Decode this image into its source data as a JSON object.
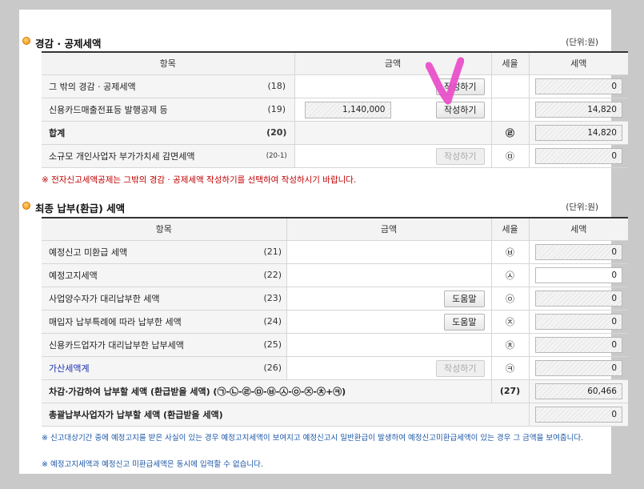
{
  "section1": {
    "title": "경감 · 공제세액",
    "unit": "(단위:원)",
    "headers": [
      "항목",
      "금액",
      "세율",
      "세액"
    ],
    "rows": [
      {
        "label": "그 밖의 경감 · 공제세액",
        "num": "(18)",
        "amount": "",
        "button": "작성하기",
        "rate": "",
        "tax": "0"
      },
      {
        "label": "신용카드매출전표등 발행공제 등",
        "num": "(19)",
        "amount": "1,140,000",
        "button": "작성하기",
        "rate": "",
        "tax": "14,820"
      },
      {
        "label": "합계",
        "num": "(20)",
        "amount": "",
        "button": "",
        "rate": "㉣",
        "tax": "14,820"
      },
      {
        "label": "소규모 개인사업자 부가가치세 감면세액",
        "num": "(20-1)",
        "amount": "",
        "button": "작성하기",
        "rate": "㉤",
        "tax": "0"
      }
    ],
    "notice": "※ 전자신고세액공제는 그밖의 경감 · 공제세액 작성하기를 선택하여 작성하시기 바랍니다."
  },
  "section2": {
    "title": "최종 납부(환급) 세액",
    "unit": "(단위:원)",
    "headers": [
      "항목",
      "금액",
      "세율",
      "세액"
    ],
    "rows": [
      {
        "label": "예정신고 미환급 세액",
        "num": "(21)",
        "button": "",
        "rate": "㉥",
        "tax": "0"
      },
      {
        "label": "예정고지세액",
        "num": "(22)",
        "button": "",
        "rate": "㉦",
        "tax": "0"
      },
      {
        "label": "사업양수자가 대리납부한 세액",
        "num": "(23)",
        "button": "도움말",
        "rate": "㉧",
        "tax": "0"
      },
      {
        "label": "매입자 납부특례에 따라 납부한 세액",
        "num": "(24)",
        "button": "도움말",
        "rate": "㉨",
        "tax": "0"
      },
      {
        "label": "신용카드업자가 대리납부한 납부세액",
        "num": "(25)",
        "button": "",
        "rate": "㉩",
        "tax": "0"
      },
      {
        "label": "가산세액계",
        "num": "(26)",
        "button": "작성하기",
        "rate": "㉪",
        "tax": "0"
      },
      {
        "label": "차감·가감하여 납부할 세액 (환급받을 세액) (㉠-㉡-㉣-㉤-㉥-㉦-㉧-㉨-㉩+㉪)",
        "num": "(27)",
        "tax": "60,466"
      },
      {
        "label": "총괄납부사업자가 납부할 세액 (환급받을 세액)",
        "tax": "0"
      }
    ],
    "notices": [
      "※ 신고대상기간 중에 예정고지를 받은 사실이 있는 경우 예정고지세액이 보여지고 예정신고시 일반환급이 발생하여 예정신고미환급세액이 있는 경우 그 금액을 보여줍니다.",
      "※ 예정고지세액과 예정신고 미환급세액은 동시에 입력할 수 없습니다."
    ]
  },
  "colors": {
    "accent_dot": "#f08c00",
    "notice_red": "#c00000",
    "notice_blue": "#1a55a6",
    "link": "#1a2fb0",
    "check": "#e94cc9"
  }
}
